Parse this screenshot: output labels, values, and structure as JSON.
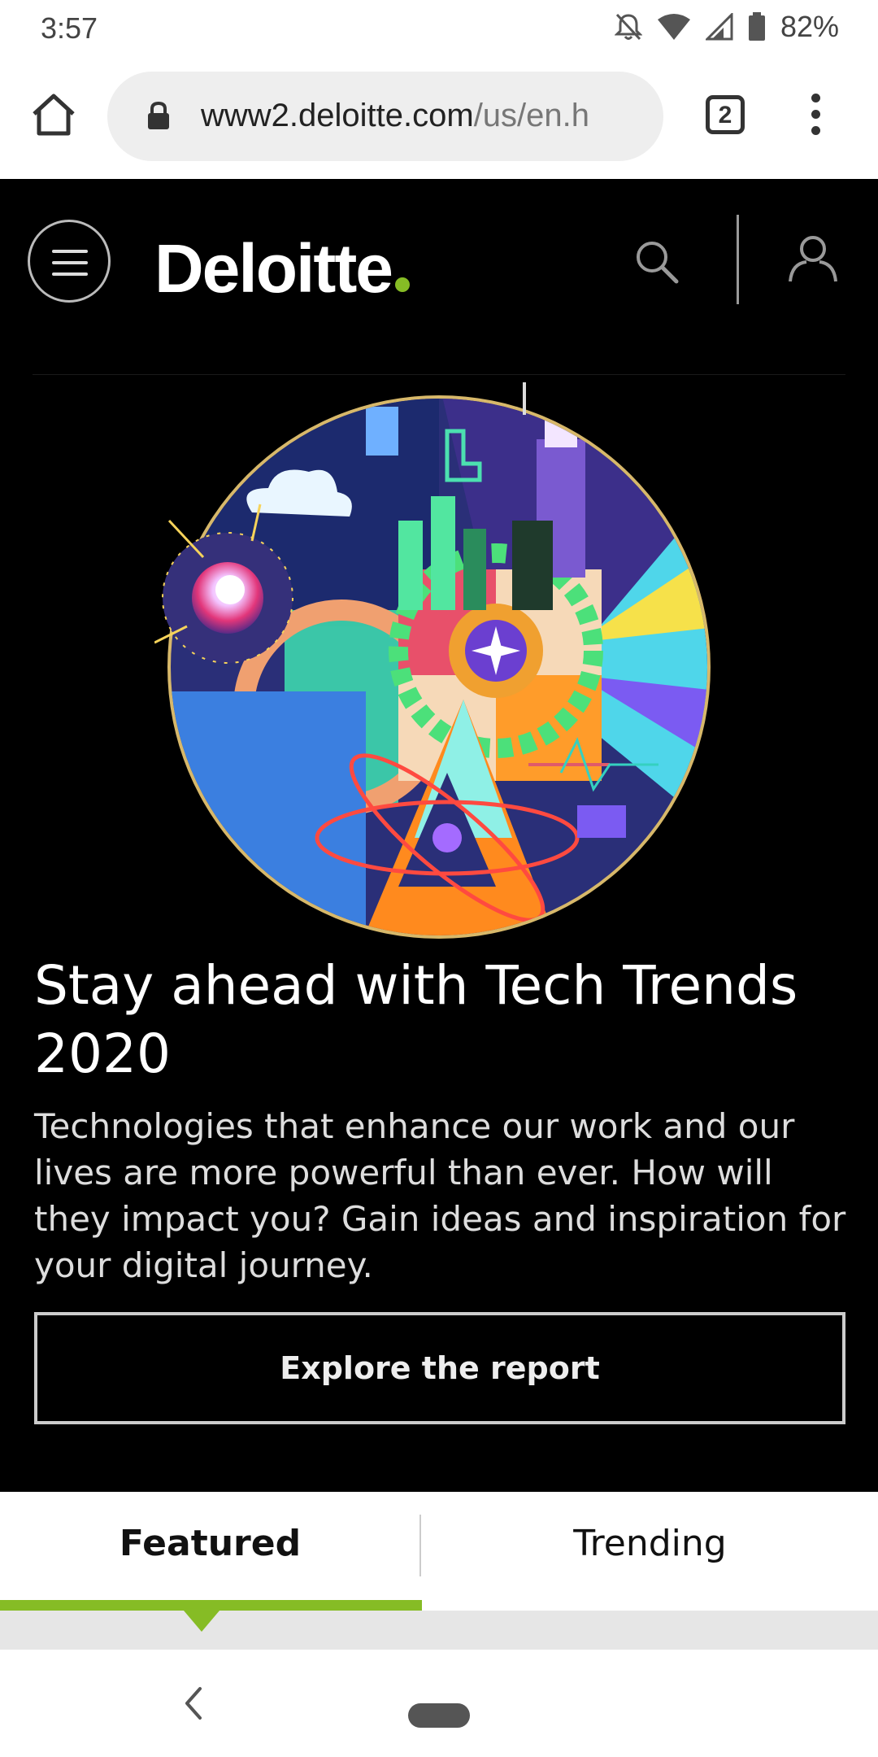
{
  "status_bar": {
    "time": "3:57",
    "battery": "82%",
    "icons": [
      "notifications-off-icon",
      "wifi-icon",
      "signal-icon",
      "battery-icon"
    ]
  },
  "browser": {
    "url_host": "www2.deloitte.com",
    "url_path": "/us/en.h",
    "tab_count": "2"
  },
  "site": {
    "logo": "Deloitte",
    "brand_color": "#86bc25"
  },
  "hero": {
    "headline": "Stay ahead with Tech Trends 2020",
    "description": "Technologies that enhance our work and our lives are more powerful than ever. How will they impact you? Gain ideas and inspiration for your digital journey.",
    "cta": "Explore the report"
  },
  "tabs": [
    {
      "label": "Featured",
      "active": true
    },
    {
      "label": "Trending",
      "active": false
    }
  ]
}
